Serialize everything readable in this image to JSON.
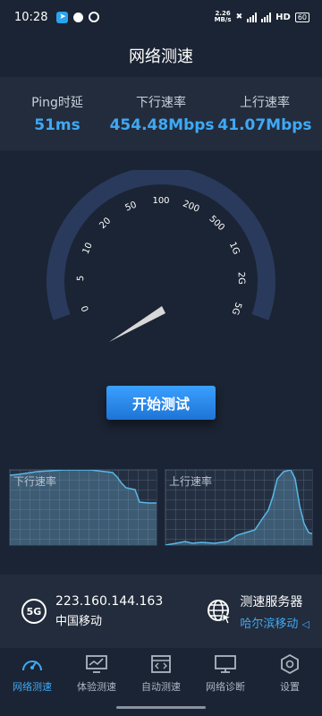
{
  "status_bar": {
    "time": "10:28",
    "net_speed_value": "2.26",
    "net_speed_unit": "MB/s",
    "network_type": "HD",
    "battery": "60"
  },
  "header": {
    "title": "网络测速"
  },
  "metrics": [
    {
      "label": "Ping时延",
      "value": "51ms"
    },
    {
      "label": "下行速率",
      "value": "454.48Mbps"
    },
    {
      "label": "上行速率",
      "value": "41.07Mbps"
    }
  ],
  "gauge": {
    "ticks": [
      "0",
      "5",
      "10",
      "20",
      "50",
      "100",
      "200",
      "500",
      "1G",
      "2G",
      "5G"
    ],
    "needle_tick_position": 1.5,
    "arc_color": "#2a3a5c"
  },
  "start_button": {
    "label": "开始测试"
  },
  "charts": {
    "download": {
      "label": "下行速率"
    },
    "upload": {
      "label": "上行速率"
    }
  },
  "info": {
    "network_badge": "5G",
    "ip": "223.160.144.163",
    "isp": "中国移动",
    "server_title": "测速服务器",
    "server_city": "哈尔滨移动"
  },
  "nav": [
    {
      "label": "网络测速",
      "icon": "speedometer-icon",
      "active": true
    },
    {
      "label": "体验测速",
      "icon": "monitor-chart-icon",
      "active": false
    },
    {
      "label": "自动测速",
      "icon": "code-window-icon",
      "active": false
    },
    {
      "label": "网络诊断",
      "icon": "desktop-icon",
      "active": false
    },
    {
      "label": "设置",
      "icon": "hexagon-gear-icon",
      "active": false
    }
  ],
  "colors": {
    "background": "#1b2434",
    "panel": "#222c3c",
    "accent": "#3fa9f5",
    "chart_line": "#5ab7e6"
  }
}
